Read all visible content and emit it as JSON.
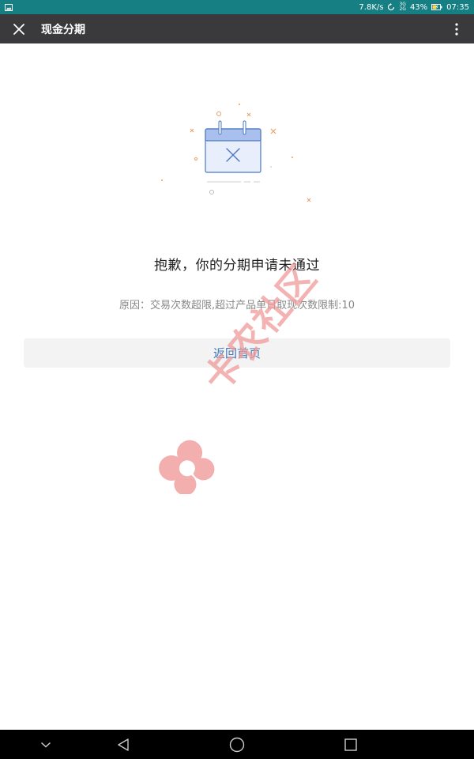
{
  "status_bar": {
    "speed": "7.8K/s",
    "signal_top": "3G",
    "signal_bottom": "2G",
    "battery": "43%",
    "time": "07:35",
    "background_color": "#157f83"
  },
  "app_bar": {
    "title": "现金分期",
    "background_color": "#3a3a3c"
  },
  "result": {
    "title": "抱歉，你的分期申请未通过",
    "reason": "原因：交易次数超限,超过产品单日取现次数限制:10"
  },
  "actions": {
    "home_button_label": "返回首页",
    "link_color": "#3f78b8"
  },
  "watermark": {
    "text": "卡农社区",
    "color": "#f19a9a"
  },
  "nav_bar": {
    "items": [
      "chevron-down-icon",
      "back-icon",
      "home-icon",
      "recent-apps-icon"
    ]
  }
}
